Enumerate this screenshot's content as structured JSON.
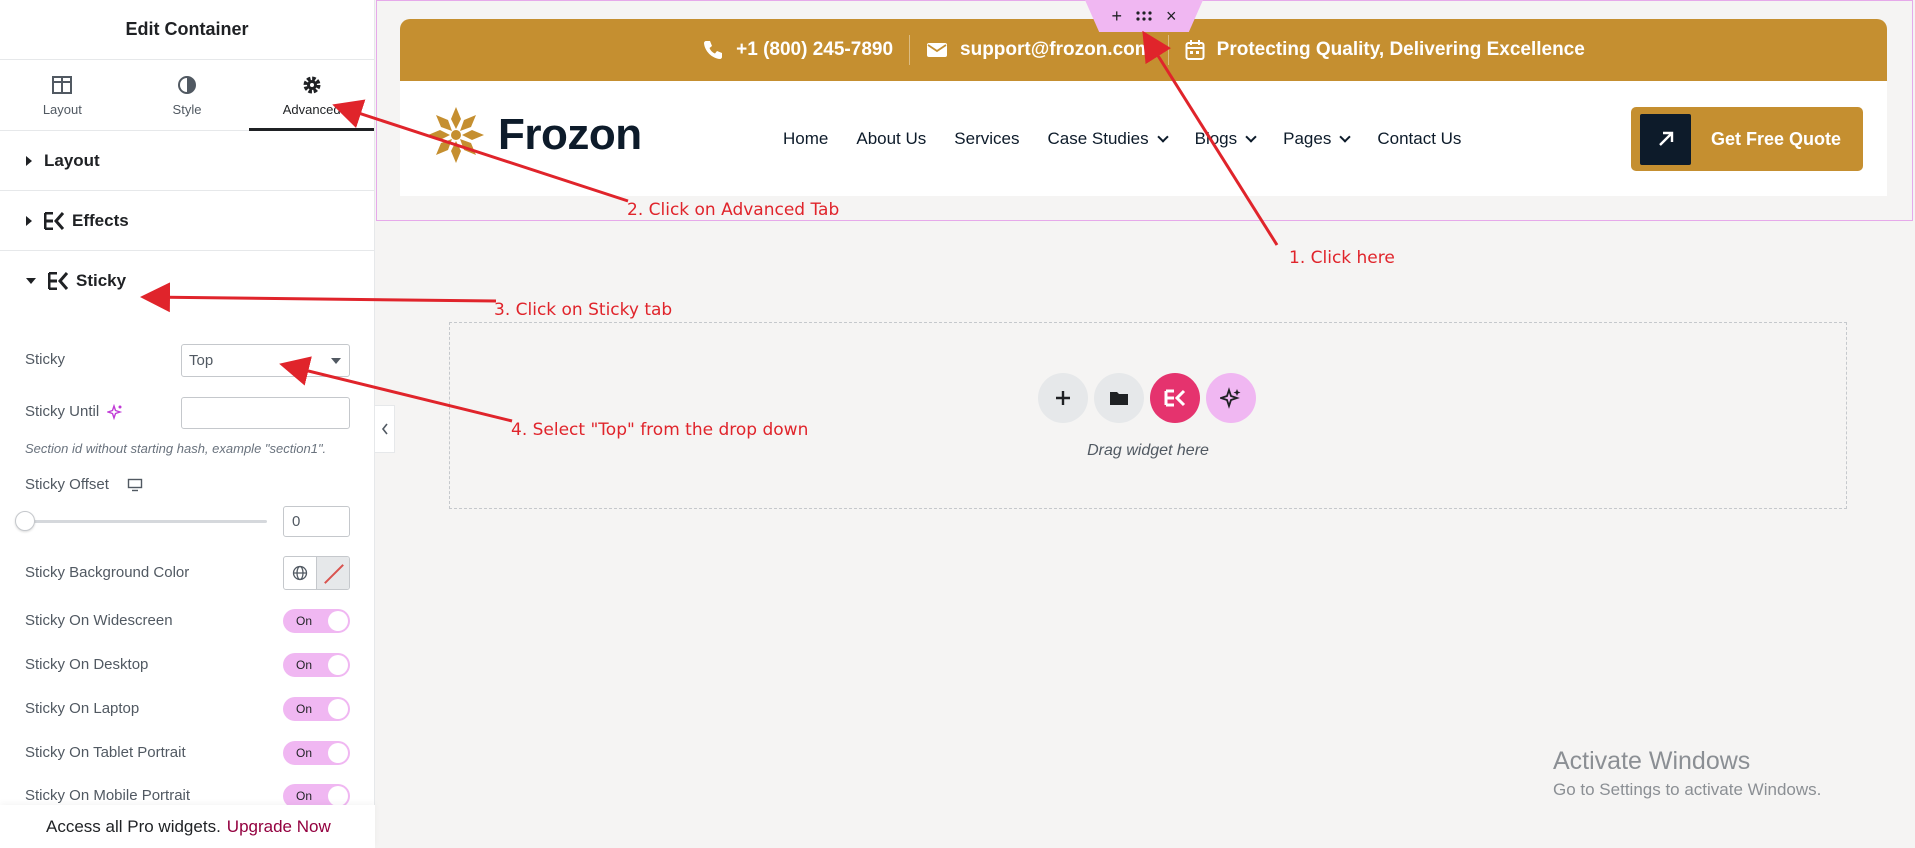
{
  "panel": {
    "title": "Edit Container",
    "tabs": [
      {
        "label": "Layout",
        "icon": "layout-icon"
      },
      {
        "label": "Style",
        "icon": "contrast-icon"
      },
      {
        "label": "Advanced",
        "icon": "gear-icon",
        "active": true
      }
    ],
    "sections": {
      "layout": "Layout",
      "effects": "Effects",
      "sticky": "Sticky"
    },
    "sticky": {
      "sticky_label": "Sticky",
      "sticky_value": "Top",
      "sticky_until_label": "Sticky Until",
      "sticky_until_value": "",
      "hint": "Section id without starting hash, example \"section1\".",
      "offset_label": "Sticky Offset",
      "offset_value": "0",
      "bg_color_label": "Sticky Background Color",
      "toggles": [
        {
          "label": "Sticky On Widescreen",
          "state": "On"
        },
        {
          "label": "Sticky On Desktop",
          "state": "On"
        },
        {
          "label": "Sticky On Laptop",
          "state": "On"
        },
        {
          "label": "Sticky On Tablet Portrait",
          "state": "On"
        },
        {
          "label": "Sticky On Mobile Portrait",
          "state": "On"
        }
      ]
    },
    "promo": {
      "text": "Access all Pro widgets.",
      "link": "Upgrade Now"
    }
  },
  "site": {
    "topbar": {
      "phone": "+1 (800) 245-7890",
      "email": "support@frozon.com",
      "tagline": "Protecting Quality, Delivering Excellence"
    },
    "logo_text": "Frozon",
    "menu": [
      {
        "label": "Home",
        "dropdown": false
      },
      {
        "label": "About Us",
        "dropdown": false
      },
      {
        "label": "Services",
        "dropdown": false
      },
      {
        "label": "Case Studies",
        "dropdown": true
      },
      {
        "label": "Blogs",
        "dropdown": true
      },
      {
        "label": "Pages",
        "dropdown": true
      },
      {
        "label": "Contact Us",
        "dropdown": false
      }
    ],
    "cta": "Get Free Quote",
    "dropzone_text": "Drag widget here"
  },
  "annotations": {
    "a1": "1. Click here",
    "a2": "2. Click on Advanced Tab",
    "a3": "3. Click on Sticky tab",
    "a4": "4. Select \"Top\" from the drop down"
  },
  "watermark": {
    "line1": "Activate Windows",
    "line2": "Go to Settings to activate Windows."
  },
  "colors": {
    "brand_gold": "#c58f30",
    "navy": "#0d1b2a",
    "toggle_on": "#f0b7f2",
    "annotation_red": "#e0242b",
    "elementor_pink": "#e5336e"
  }
}
